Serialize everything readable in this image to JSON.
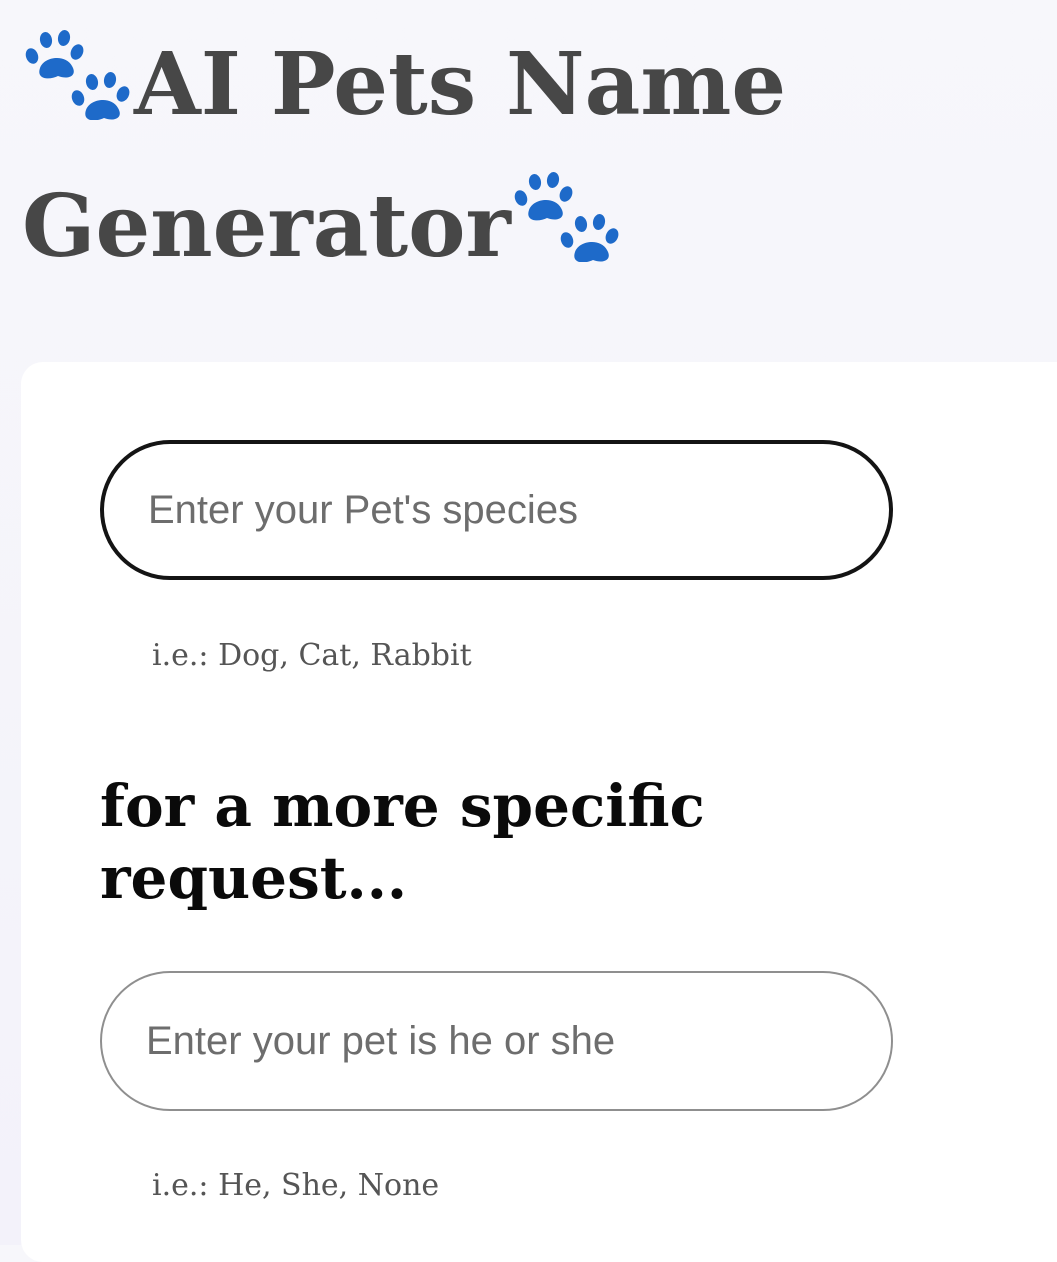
{
  "header": {
    "title": "AI Pets Name Generator",
    "paw_icon": "paw-prints-icon",
    "paw_color": "#1e6ac9"
  },
  "form": {
    "species_input": {
      "placeholder": "Enter your Pet's species",
      "value": "",
      "hint": "i.e.: Dog, Cat, Rabbit"
    },
    "specific_heading": "for a more specific request...",
    "gender_input": {
      "placeholder": "Enter your pet is he or she",
      "value": "",
      "hint": "i.e.: He, She, None"
    }
  }
}
